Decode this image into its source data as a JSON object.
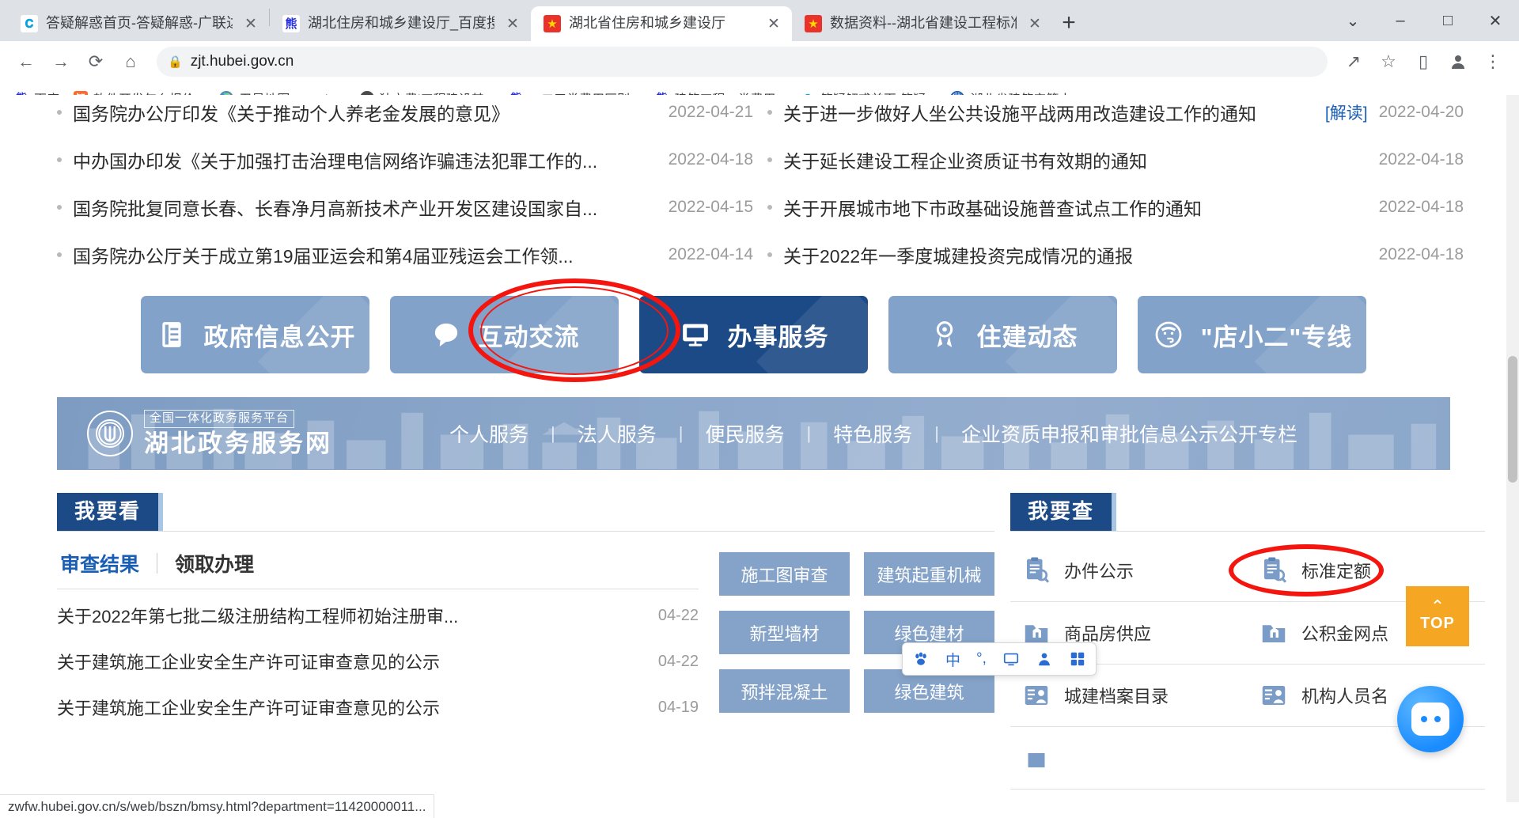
{
  "browser": {
    "tabs": [
      {
        "title": "答疑解惑首页-答疑解惑-广联达服",
        "favicon": "gld-icon",
        "active": false
      },
      {
        "title": "湖北住房和城乡建设厅_百度搜索",
        "favicon": "baidu-icon",
        "active": false
      },
      {
        "title": "湖北省住房和城乡建设厅",
        "favicon": "gov-emblem-icon",
        "active": true
      },
      {
        "title": "数据资料--湖北省建设工程标准定",
        "favicon": "gov-emblem-icon",
        "active": false
      }
    ],
    "new_tab_label": "+",
    "window_controls": {
      "minimize": "–",
      "maximize": "□",
      "close": "✕",
      "chevron": "⌄"
    },
    "toolbar": {
      "back": "←",
      "forward": "→",
      "reload": "⟳",
      "home": "⌂",
      "share": "↗",
      "bookmark": "☆",
      "sidepanel": "▯",
      "profile": "●",
      "menu": "⋮"
    },
    "address": {
      "lock_icon": "lock-icon",
      "url": "zjt.hubei.gov.cn"
    },
    "bookmarks": [
      {
        "label": "百度",
        "icon": "baidu-icon"
      },
      {
        "label": "软件开发怎么报价...",
        "icon": "zhihu-icon"
      },
      {
        "label": "卫星地图-Google...",
        "icon": "globe-icon"
      },
      {
        "label": "独立费|工程建设其...",
        "icon": "sphere-icon"
      },
      {
        "label": "一二三类费用区别...",
        "icon": "baidu-icon"
      },
      {
        "label": "建筑工程一类费用...",
        "icon": "baidu-icon"
      },
      {
        "label": "答疑解惑首页-答疑...",
        "icon": "gld-icon"
      },
      {
        "label": "湖北省建筑安管人...",
        "icon": "anguan-icon"
      }
    ],
    "bookmarks_overflow": "»",
    "status_url": "zwfw.hubei.gov.cn/s/web/bszn/bmsy.html?department=11420000011..."
  },
  "news": {
    "left": [
      {
        "title": "国务院办公厅印发《关于推动个人养老金发展的意见》",
        "date": "2022-04-21"
      },
      {
        "title": "中办国办印发《关于加强打击治理电信网络诈骗违法犯罪工作的...",
        "date": "2022-04-18"
      },
      {
        "title": "国务院批复同意长春、长春净月高新技术产业开发区建设国家自...",
        "date": "2022-04-15"
      },
      {
        "title": "国务院办公厅关于成立第19届亚运会和第4届亚残运会工作领...",
        "date": "2022-04-14"
      }
    ],
    "right": [
      {
        "title": "关于进一步做好人坐公共设施平战两用改造建设工作的通知",
        "tag": "[解读]",
        "date": "2022-04-20"
      },
      {
        "title": "关于延长建设工程企业资质证书有效期的通知",
        "tag": "",
        "date": "2022-04-18"
      },
      {
        "title": "关于开展城市地下市政基础设施普查试点工作的通知",
        "tag": "",
        "date": "2022-04-18"
      },
      {
        "title": "关于2022年一季度城建投资完成情况的通报",
        "tag": "",
        "date": "2022-04-18"
      }
    ]
  },
  "channels": [
    {
      "label": "政府信息公开",
      "icon": "document-list-icon",
      "active": false
    },
    {
      "label": "互动交流",
      "icon": "chat-bubble-icon",
      "active": false
    },
    {
      "label": "办事服务",
      "icon": "monitor-icon",
      "active": true
    },
    {
      "label": "住建动态",
      "icon": "award-ribbon-icon",
      "active": false
    },
    {
      "label": "\"店小二\"专线",
      "icon": "headset-person-icon",
      "active": false
    }
  ],
  "gov_banner": {
    "seal_icon": "national-platform-seal-icon",
    "subtitle": "全国一体化政务服务平台",
    "title": "湖北政务服务网",
    "links": [
      "个人服务",
      "法人服务",
      "便民服务",
      "特色服务",
      "企业资质申报和审批信息公示公开专栏"
    ],
    "divider": "|"
  },
  "panel_look": {
    "tag": "我要看",
    "subtabs": [
      {
        "label": "审查结果",
        "active": true
      },
      {
        "label": "领取办理",
        "active": false
      }
    ],
    "items": [
      {
        "title": "关于2022年第七批二级注册结构工程师初始注册审...",
        "date": "04-22"
      },
      {
        "title": "关于建筑施工企业安全生产许可证审查意见的公示",
        "date": "04-22"
      },
      {
        "title": "关于建筑施工企业安全生产许可证审查意见的公示",
        "date": "04-19"
      }
    ],
    "tag_buttons_col1": [
      "施工图审查",
      "新型墙材",
      "预拌混凝土"
    ],
    "tag_buttons_col2": [
      "建筑起重机械",
      "绿色建材",
      "绿色建筑"
    ]
  },
  "panel_check": {
    "tag": "我要查",
    "items": [
      {
        "label": "办件公示",
        "icon": "clipboard-search-icon"
      },
      {
        "label": "标准定额",
        "icon": "clipboard-search-icon",
        "highlighted": true
      },
      {
        "label": "商品房供应",
        "icon": "folder-building-icon"
      },
      {
        "label": "公积金网点",
        "icon": "folder-building-icon"
      },
      {
        "label": "城建档案目录",
        "icon": "person-card-icon"
      },
      {
        "label": "机构人员名",
        "icon": "person-card-icon"
      }
    ]
  },
  "widgets": {
    "top_button": {
      "caret": "⌃",
      "label": "TOP"
    },
    "chatbot_icon": "robot-assistant-icon",
    "ime_items": [
      "sogou-paw-icon",
      "中",
      "°,",
      "monitor-icon",
      "person-icon",
      "grid-icon"
    ]
  }
}
